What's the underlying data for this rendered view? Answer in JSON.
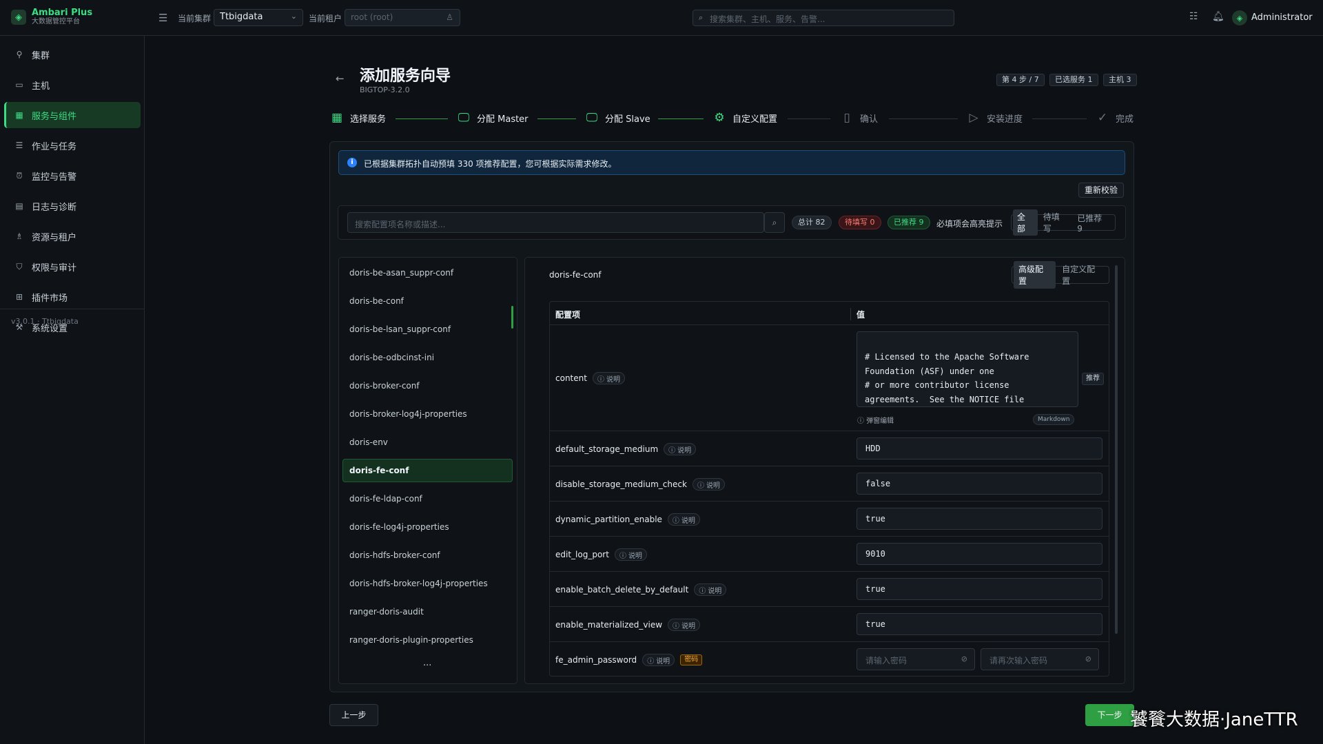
{
  "app": {
    "name": "Ambari Plus",
    "subtitle": "大数据管控平台"
  },
  "topbar": {
    "cluster_label": "当前集群",
    "cluster_value": "Ttbigdata",
    "tenant_label": "当前租户",
    "tenant_placeholder": "root (root)",
    "search_placeholder": "搜索集群、主机、服务、告警...",
    "user_name": "Administrator"
  },
  "sidebar": {
    "items": [
      {
        "label": "集群",
        "icon": "rocket-icon"
      },
      {
        "label": "主机",
        "icon": "monitor-icon"
      },
      {
        "label": "服务与组件",
        "icon": "grid-icon",
        "active": true
      },
      {
        "label": "作业与任务",
        "icon": "list-icon"
      },
      {
        "label": "监控与告警",
        "icon": "alarm-icon"
      },
      {
        "label": "日志与诊断",
        "icon": "log-icon"
      },
      {
        "label": "资源与租户",
        "icon": "users-icon"
      },
      {
        "label": "权限与审计",
        "icon": "shield-icon"
      },
      {
        "label": "插件市场",
        "icon": "plugin-icon"
      },
      {
        "label": "系统设置",
        "icon": "wrench-icon"
      }
    ],
    "version": "v3.0.1 · Ttbigdata"
  },
  "wizard": {
    "title": "添加服务向导",
    "subtitle": "BIGTOP-3.2.0",
    "badges": [
      "第 4 步 / 7",
      "已选服务 1",
      "主机 3"
    ],
    "steps": [
      {
        "label": "选择服务",
        "state": "done",
        "icon": "grid-icon"
      },
      {
        "label": "分配 Master",
        "state": "done",
        "icon": "monitor-icon"
      },
      {
        "label": "分配 Slave",
        "state": "done",
        "icon": "monitor-icon"
      },
      {
        "label": "自定义配置",
        "state": "current",
        "icon": "gear-icon"
      },
      {
        "label": "确认",
        "state": "pending",
        "icon": "document-icon"
      },
      {
        "label": "安装进度",
        "state": "pending",
        "icon": "play-icon"
      },
      {
        "label": "完成",
        "state": "pending",
        "icon": "check-circle-icon"
      }
    ]
  },
  "info_banner": "已根据集群拓扑自动预填 330 项推荐配置，您可根据实际需求修改。",
  "recheck_button": "重新校验",
  "filter": {
    "search_placeholder": "搜索配置项名称或描述...",
    "total": "总计 82",
    "pending": "待填写 0",
    "recommended": "已推荐 9",
    "hint": "必填项会高亮提示",
    "segments": [
      "全部",
      "待填写",
      "已推荐 9"
    ],
    "active_segment": "全部"
  },
  "config_files": [
    "doris-be-asan_suppr-conf",
    "doris-be-conf",
    "doris-be-lsan_suppr-conf",
    "doris-be-odbcinst-ini",
    "doris-broker-conf",
    "doris-broker-log4j-properties",
    "doris-env",
    "doris-fe-conf",
    "doris-fe-ldap-conf",
    "doris-fe-log4j-properties",
    "doris-hdfs-broker-conf",
    "doris-hdfs-broker-log4j-properties",
    "ranger-doris-audit",
    "ranger-doris-plugin-properties"
  ],
  "config_files_more": "...",
  "selected_file": "doris-fe-conf",
  "detail": {
    "title": "doris-fe-conf",
    "tabs": [
      "高级配置",
      "自定义配置"
    ],
    "active_tab": "高级配置",
    "col_key": "配置项",
    "col_value": "值",
    "explain_label": "说明",
    "recommend_label": "推荐",
    "popup_edit": "弹窗编辑",
    "markdown_tag": "Markdown",
    "password_tag": "密码",
    "content_key": "content",
    "content_value": "# Licensed to the Apache Software\nFoundation (ASF) under one\n# or more contributor license\nagreements.  See the NOTICE file",
    "properties": [
      {
        "name": "default_storage_medium",
        "value": "HDD"
      },
      {
        "name": "disable_storage_medium_check",
        "value": "false"
      },
      {
        "name": "dynamic_partition_enable",
        "value": "true"
      },
      {
        "name": "edit_log_port",
        "value": "9010"
      },
      {
        "name": "enable_batch_delete_by_default",
        "value": "true"
      },
      {
        "name": "enable_materialized_view",
        "value": "true"
      }
    ],
    "password_key": "fe_admin_password",
    "password_placeholder": "请输入密码",
    "password_confirm_placeholder": "请再次输入密码"
  },
  "footer": {
    "prev": "上一步",
    "next": "下一步"
  },
  "watermark": "饕餮大数据·JaneTTR",
  "colors": {
    "accent": "#3ddc84",
    "accent_dark": "#2ea043",
    "info": "#2f81f7",
    "danger": "#ff7b72",
    "warning": "#f0a93a"
  }
}
